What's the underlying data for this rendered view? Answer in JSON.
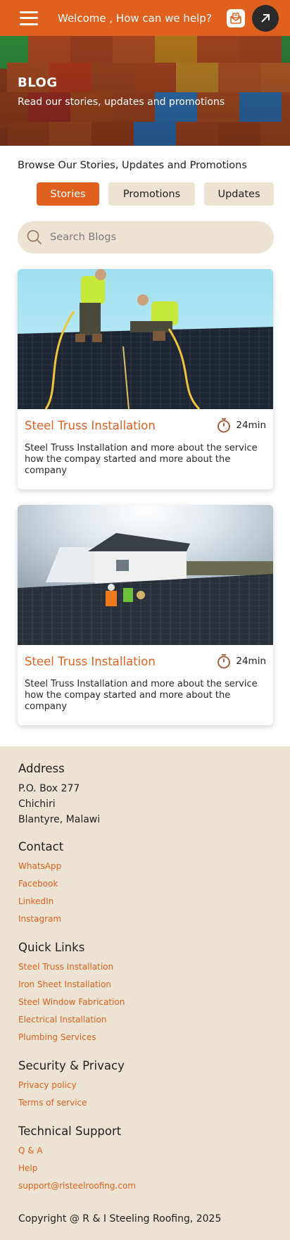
{
  "header": {
    "welcome_text": "Welcome , How can we help?",
    "menu_icon": "hamburger-icon",
    "mail_icon": "mail-icon",
    "arrow_icon": "arrow-up-right-icon"
  },
  "hero": {
    "title": "BLOG",
    "subtitle": "Read our stories, updates and promotions"
  },
  "browse": {
    "heading": "Browse Our Stories, Updates and Promotions",
    "tabs": [
      {
        "label": "Stories",
        "active": true
      },
      {
        "label": "Promotions",
        "active": false
      },
      {
        "label": "Updates",
        "active": false
      }
    ]
  },
  "search": {
    "placeholder": "Search Blogs",
    "value": ""
  },
  "posts": [
    {
      "title": "Steel Truss Installation",
      "read_time": "24min",
      "description": "Steel Truss Installation and more about the service how the compay started and more about the company"
    },
    {
      "title": "Steel Truss Installation",
      "read_time": "24min",
      "description": "Steel Truss Installation and more about the service how the compay started and more about the company"
    }
  ],
  "footer": {
    "address": {
      "heading": "Address",
      "line1": "P.O. Box 277",
      "line2": "Chichiri",
      "line3": "Blantyre, Malawi"
    },
    "contact": {
      "heading": "Contact",
      "links": [
        "WhatsApp",
        "Facebook",
        "LinkedIn",
        "Instagram"
      ]
    },
    "quick_links": {
      "heading": "Quick Links",
      "links": [
        "Steel Truss Installation",
        "Iron Sheet Installation",
        "Steel Window Fabrication",
        "Electrical Installation",
        "Plumbing Services"
      ]
    },
    "security": {
      "heading": "Security & Privacy",
      "links": [
        "Privacy policy",
        "Terms of service"
      ]
    },
    "support": {
      "heading": "Technical Support",
      "links": [
        "Q & A",
        "Help",
        "support@risteelroofing.com"
      ]
    },
    "copyright": "Copyright @ R & I Steeling Roofing, 2025"
  },
  "colors": {
    "accent": "#e0601f",
    "beige": "#ece3d3",
    "dark": "#2a2a2a"
  }
}
